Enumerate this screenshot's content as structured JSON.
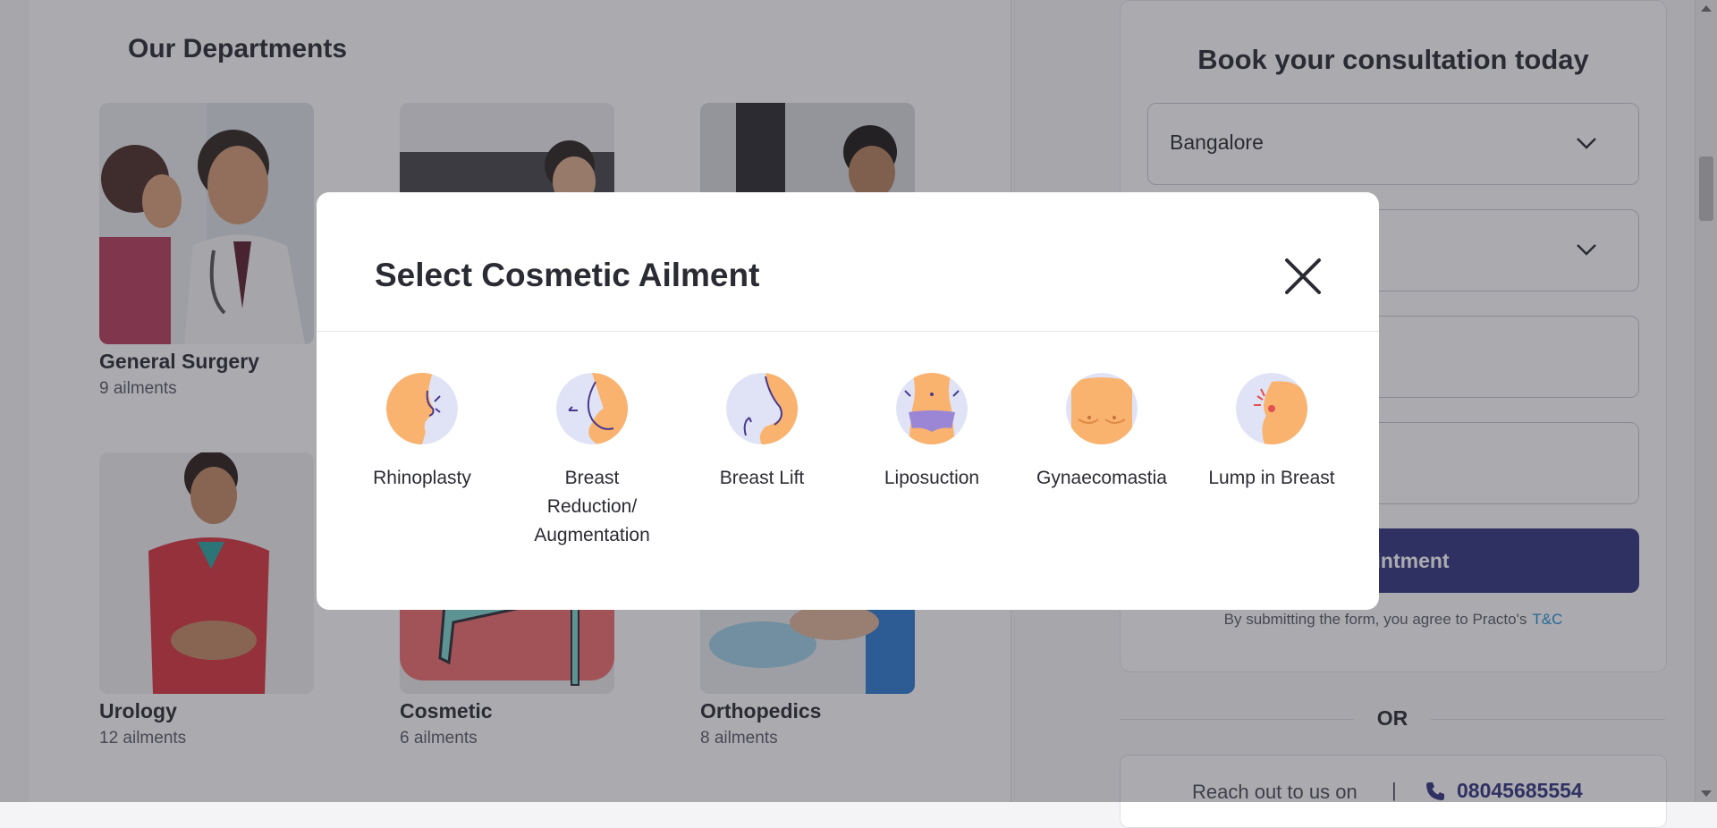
{
  "departments": {
    "title": "Our Departments",
    "items": [
      {
        "name": "General Surgery",
        "sub": "9 ailments"
      },
      {
        "name": "",
        "sub": ""
      },
      {
        "name": "",
        "sub": ""
      },
      {
        "name": "Urology",
        "sub": "12 ailments"
      },
      {
        "name": "Cosmetic",
        "sub": "6 ailments"
      },
      {
        "name": "Orthopedics",
        "sub": "8 ailments"
      }
    ]
  },
  "booking": {
    "title": "Book your consultation today",
    "city": "Bangalore",
    "button": "ppointment",
    "terms": "By submitting the form, you agree to Practo's",
    "terms_link": "T&C",
    "or": "OR",
    "reach": "Reach out to us on",
    "sep": "|",
    "phone": "08045685554"
  },
  "modal": {
    "title": "Select Cosmetic Ailment",
    "ailments": [
      {
        "label": "Rhinoplasty",
        "icon": "nose-icon"
      },
      {
        "label": "Breast Reduction/ Augmentation",
        "icon": "breast-augmentation-icon"
      },
      {
        "label": "Breast Lift",
        "icon": "breast-lift-icon"
      },
      {
        "label": "Liposuction",
        "icon": "liposuction-icon"
      },
      {
        "label": "Gynaecomastia",
        "icon": "chest-icon"
      },
      {
        "label": "Lump in Breast",
        "icon": "lump-icon"
      }
    ]
  },
  "colors": {
    "primary": "#333580",
    "link": "#1f8fd2",
    "skin": "#f9b36f",
    "icon_bg": "#dfe3f5"
  }
}
